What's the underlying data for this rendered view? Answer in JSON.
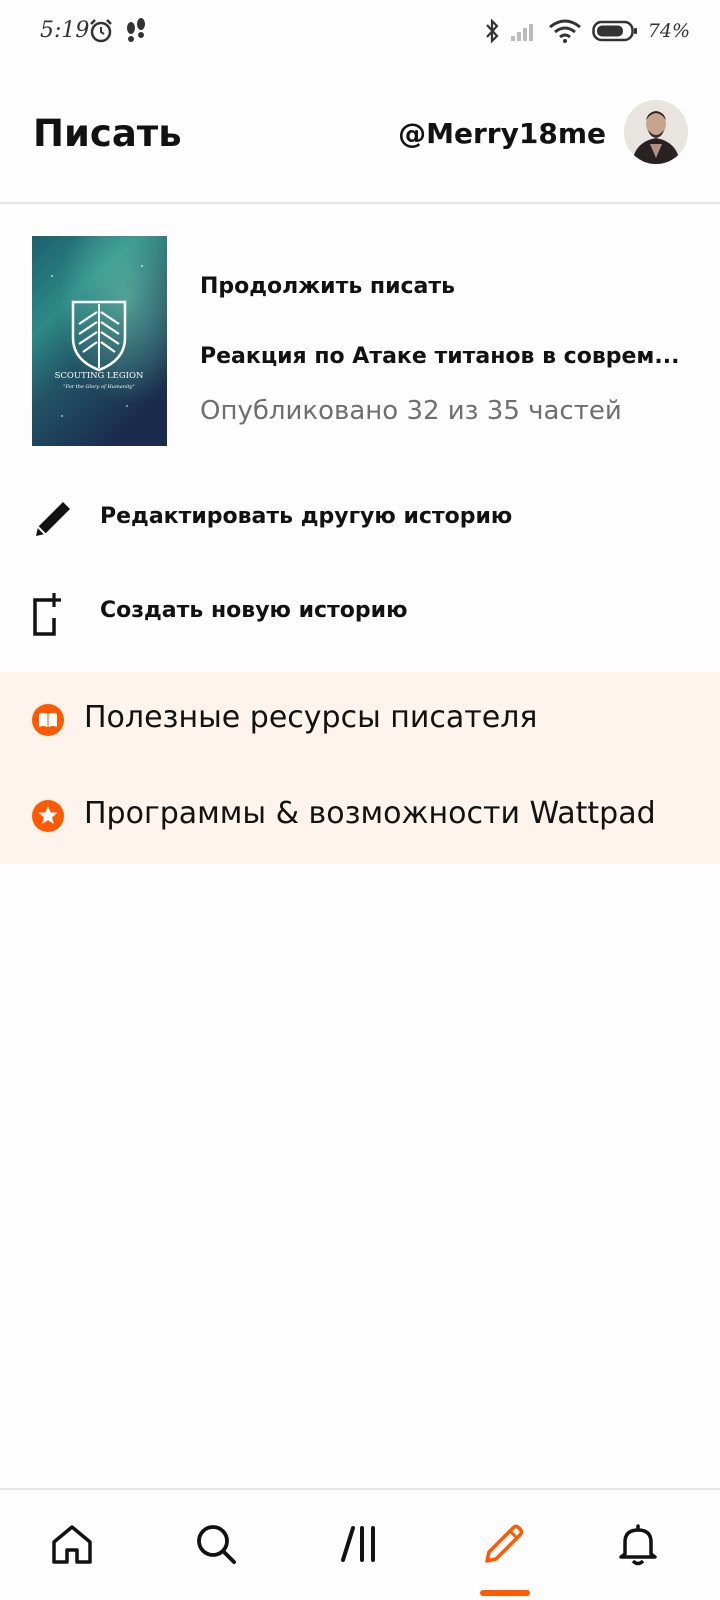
{
  "status_bar": {
    "time": "5:19",
    "battery_percent": "74%",
    "icons": [
      "alarm-icon",
      "footsteps-icon",
      "bluetooth-icon",
      "signal-icon",
      "wifi-icon",
      "battery-icon"
    ]
  },
  "header": {
    "title": "Писать",
    "username": "@Merry18me"
  },
  "continue_writing": {
    "label": "Продолжить писать",
    "story_title": "Реакция по Атаке титанов в соврем...",
    "status": "Опубликовано 32 из 35 частей",
    "cover_text_line1": "SCOUTING LEGION",
    "cover_text_line2": "\"For the Glory of Humanity\""
  },
  "menu": {
    "edit_other": "Редактировать другую историю",
    "create_new": "Создать новую историю"
  },
  "resources": {
    "writer_resources": "Полезные ресурсы писателя",
    "programs": "Программы & возможности Wattpad"
  },
  "bottom_nav": {
    "items": [
      "home-icon",
      "search-icon",
      "library-icon",
      "write-icon",
      "notifications-icon"
    ],
    "active": "write-icon"
  },
  "colors": {
    "accent": "#ff5a00",
    "resources_bg": "#fff3ee",
    "text": "#121212",
    "muted": "#6f6f6f"
  }
}
